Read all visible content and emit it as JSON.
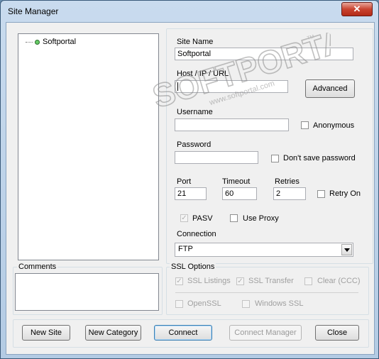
{
  "window": {
    "title": "Site Manager",
    "close_glyph": "✕"
  },
  "tree": {
    "items": [
      {
        "label": "Softportal"
      }
    ]
  },
  "site": {
    "site_name_label": "Site Name",
    "site_name_value": "Softportal",
    "host_label": "Host / IP / URL",
    "host_value": "",
    "advanced_label": "Advanced",
    "username_label": "Username",
    "username_value": "",
    "anonymous_label": "Anonymous",
    "password_label": "Password",
    "password_value": "",
    "dont_save_label": "Don't save password",
    "port_label": "Port",
    "port_value": "21",
    "timeout_label": "Timeout",
    "timeout_value": "60",
    "retries_label": "Retries",
    "retries_value": "2",
    "retry_on_label": "Retry On",
    "pasv_label": "PASV",
    "pasv_checked": true,
    "use_proxy_label": "Use Proxy",
    "connection_label": "Connection",
    "connection_value": "FTP"
  },
  "comments": {
    "label": "Comments",
    "value": ""
  },
  "ssl": {
    "group_label": "SSL Options",
    "ssl_listings_label": "SSL Listings",
    "ssl_transfer_label": "SSL Transfer",
    "clear_ccc_label": "Clear (CCC)",
    "openssl_label": "OpenSSL",
    "windows_ssl_label": "Windows SSL"
  },
  "buttons": {
    "new_site": "New Site",
    "new_category": "New Category",
    "connect": "Connect",
    "connect_manager": "Connect Manager",
    "close": "Close"
  },
  "watermark": {
    "brand": "SOFTPORTAL",
    "url": "www.softportal.com",
    "tm": "TM"
  },
  "colors": {
    "close_button": "#c9432f",
    "title_bar": "#b3cbe4"
  }
}
